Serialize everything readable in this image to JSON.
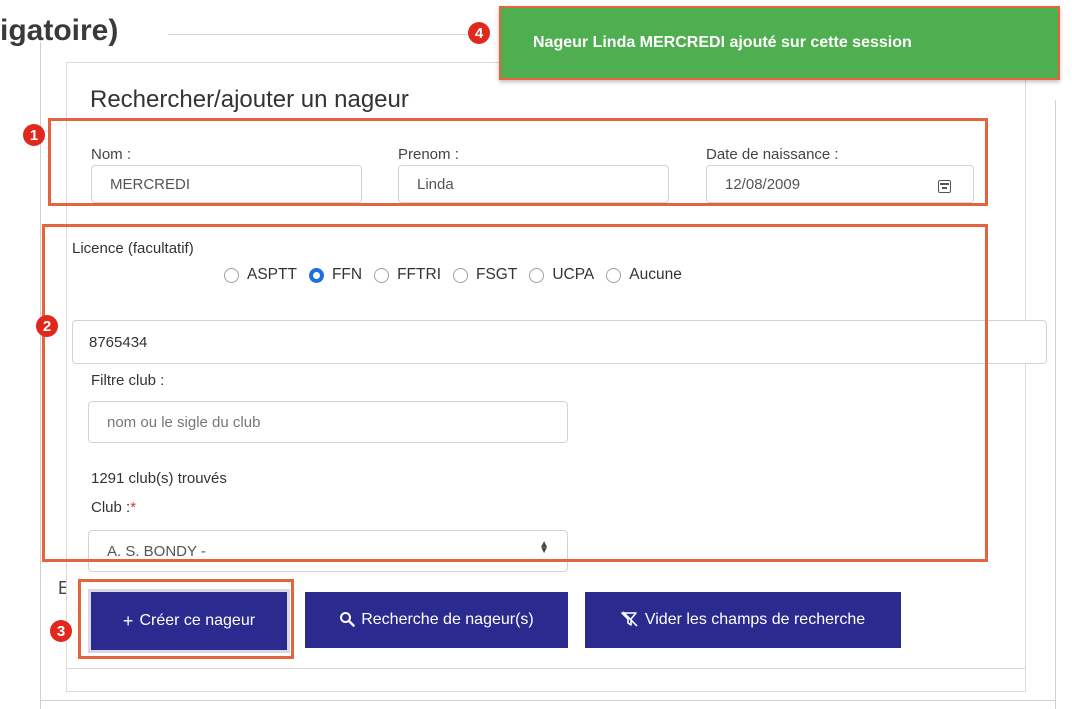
{
  "background": {
    "heading": "igatoire)",
    "stray_char": "E"
  },
  "form": {
    "title": "Rechercher/ajouter un nageur",
    "nom": {
      "label": "Nom :",
      "value": "MERCREDI"
    },
    "prenom": {
      "label": "Prenom :",
      "value": "Linda"
    },
    "date_naissance": {
      "label": "Date de naissance :",
      "value": "12/08/2009",
      "icon": "calendar-icon"
    },
    "licence": {
      "label": "Licence (facultatif)",
      "options": [
        "ASPTT",
        "FFN",
        "FFTRI",
        "FSGT",
        "UCPA",
        "Aucune"
      ],
      "selected": "FFN",
      "number": "8765434"
    },
    "filtre_club": {
      "label": "Filtre club :",
      "placeholder": "nom ou le sigle du club"
    },
    "clubs_found": "1291 club(s) trouvés",
    "club": {
      "label": "Club :",
      "required_mark": "*",
      "value": "A. S. BONDY -"
    }
  },
  "buttons": {
    "create": "Créer ce nageur",
    "search": "Recherche de nageur(s)",
    "clear": "Vider les champs de recherche"
  },
  "toast": {
    "message": "Nageur Linda MERCREDI ajouté sur cette session"
  },
  "annotations": [
    "1",
    "2",
    "3",
    "4"
  ],
  "colors": {
    "button": "#2b2a8f",
    "toast": "#4fae4f",
    "annotation": "#e5643d",
    "badge": "#e0281c",
    "radio_checked": "#1f6fe0"
  }
}
